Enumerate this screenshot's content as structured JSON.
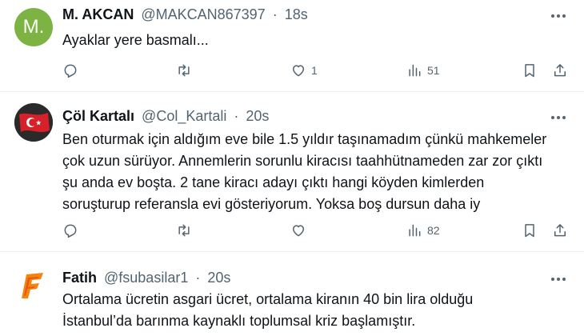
{
  "tweets": [
    {
      "avatar_letter": "M.",
      "avatar_color": "#7cb342",
      "name": "M. AKCAN",
      "handle": "@MAKCAN867397",
      "separator": "·",
      "time": "18s",
      "lines": [
        "Ayaklar yere basmalı..."
      ],
      "replies": "",
      "retweets": "",
      "likes": "1",
      "views": "51"
    },
    {
      "avatar_desc": "flag-icon",
      "name": "Çöl Kartalı",
      "handle": "@Col_Kartali",
      "separator": "·",
      "time": "20s",
      "lines": [
        "Ben oturmak için aldığım eve bile 1.5 yıldır taşınamadım çünkü mahkemeler",
        "çok uzun sürüyor. Annemlerin sorunlu kiracısı taahhütnameden zar zor çıktı",
        "şu anda ev boşta. 2 tane kiracı adayı çıktı hangi köyden kimlerden",
        "soruşturup referansla evi gösteriyorum. Yoksa boş dursun daha iy"
      ],
      "replies": "",
      "retweets": "",
      "likes": "",
      "views": "82"
    },
    {
      "avatar_desc": "flame-logo-icon",
      "name": "Fatih",
      "handle": "@fsubasilar1",
      "separator": "·",
      "time": "20s",
      "lines": [
        "Ortalama ücretin asgari ücret, ortalama kiranın 40 bin lira olduğu",
        "İstanbul’da barınma kaynaklı toplumsal kriz başlamıştır."
      ]
    }
  ]
}
